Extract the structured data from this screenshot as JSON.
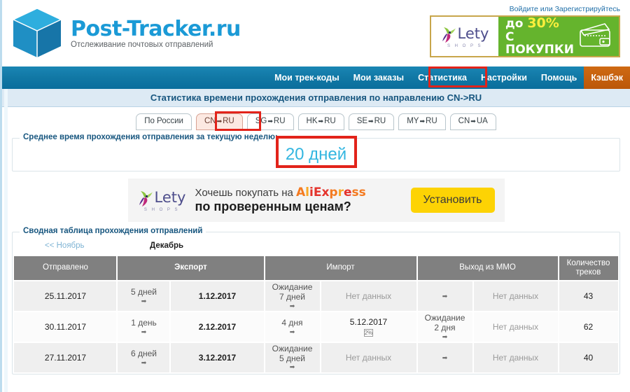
{
  "header": {
    "logo_title": "Post-Tracker.ru",
    "logo_subtitle": "Отслеживание почтовых отправлений",
    "auth_login": "Войдите",
    "auth_or": " или ",
    "auth_register": "Зарегистрируйтесь",
    "banner": {
      "brand": "Lety",
      "brand_sub": "S H O P S",
      "line1_pre": "до ",
      "line1_pct": "30%",
      "line2": "С ПОКУПКИ"
    }
  },
  "nav": {
    "items": [
      {
        "label": "Мои трек-коды",
        "active": false
      },
      {
        "label": "Мои заказы",
        "active": false
      },
      {
        "label": "Статистика",
        "active": true
      },
      {
        "label": "Настройки",
        "active": false
      },
      {
        "label": "Помощь",
        "active": false
      },
      {
        "label": "Кэшбэк",
        "active": false
      }
    ],
    "highlight_color": "#e2231a"
  },
  "page_title": "Статистика времени прохождения отправления по направлению CN->RU",
  "tabs": [
    {
      "label": "По России",
      "arrow": false,
      "active": false
    },
    {
      "label_left": "CN",
      "label_right": "RU",
      "arrow": true,
      "active": true
    },
    {
      "label_left": "SG",
      "label_right": "RU",
      "arrow": true,
      "active": false
    },
    {
      "label_left": "HK",
      "label_right": "RU",
      "arrow": true,
      "active": false
    },
    {
      "label_left": "SE",
      "label_right": "RU",
      "arrow": true,
      "active": false
    },
    {
      "label_left": "MY",
      "label_right": "RU",
      "arrow": true,
      "active": false
    },
    {
      "label_left": "CN",
      "label_right": "UA",
      "arrow": true,
      "active": false
    }
  ],
  "average": {
    "legend": "Среднее время прохождения отправления за текущую неделю:",
    "value": "20 дней",
    "value_color": "#34b6e0"
  },
  "ad": {
    "brand": "Lety",
    "brand_sub": "S H O P S",
    "line1_pre": "Хочешь покупать на ",
    "line1_brand": "AliExpress",
    "line2": "по проверенным ценам?",
    "button": "Установить"
  },
  "table_section": {
    "legend": "Сводная таблица прохождения отправлений",
    "prev_month": "<< Ноябрь",
    "current_month": "Декабрь",
    "headers": [
      "Отправлено",
      "Экспорт",
      "Импорт",
      "Выход из ММО",
      "Количество треков"
    ],
    "rows": [
      {
        "sent": "25.11.2017",
        "t1": "5 дней",
        "export": "1.12.2017",
        "t2_a": "Ожидание",
        "t2_b": "7 дней",
        "import": "Нет данных",
        "import_progress": "",
        "t3_a": "",
        "t3_b": "",
        "mmo": "Нет данных",
        "tracks": "43"
      },
      {
        "sent": "30.11.2017",
        "t1": "1 день",
        "export": "2.12.2017",
        "t2_a": "4 дня",
        "t2_b": "",
        "import": "5.12.2017",
        "import_progress": "2%",
        "t3_a": "Ожидание",
        "t3_b": "2 дня",
        "mmo": "Нет данных",
        "tracks": "62"
      },
      {
        "sent": "27.11.2017",
        "t1": "6 дней",
        "export": "3.12.2017",
        "t2_a": "Ожидание",
        "t2_b": "5 дней",
        "import": "Нет данных",
        "import_progress": "",
        "t3_a": "",
        "t3_b": "",
        "mmo": "Нет данных",
        "tracks": "40"
      }
    ]
  }
}
